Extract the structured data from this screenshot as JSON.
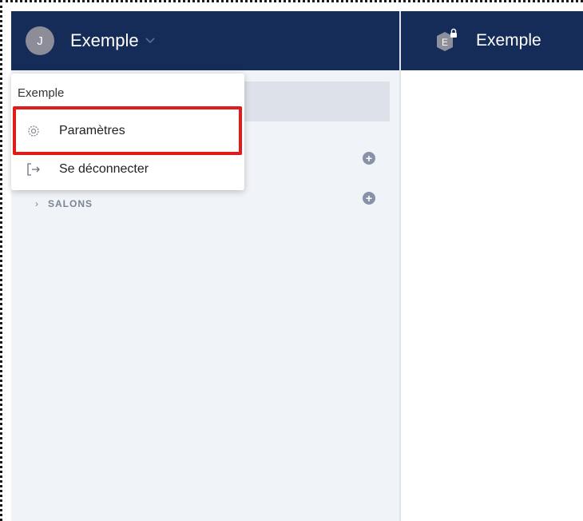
{
  "header": {
    "avatar_initial": "J",
    "workspace_name": "Exemple",
    "channel_icon_letter": "E",
    "channel_name": "Exemple"
  },
  "dropdown": {
    "header": "Exemple",
    "items": [
      {
        "label": "Paramètres",
        "icon": "gear-icon"
      },
      {
        "label": "Se déconnecter",
        "icon": "logout-icon"
      }
    ]
  },
  "sidebar": {
    "sections": [
      {
        "label": ""
      },
      {
        "label": "SALONS"
      }
    ]
  },
  "colors": {
    "header_bg": "#142c57",
    "sidebar_bg": "#f0f3f7",
    "highlight": "#e11a1a",
    "avatar": "#8c8d99"
  }
}
